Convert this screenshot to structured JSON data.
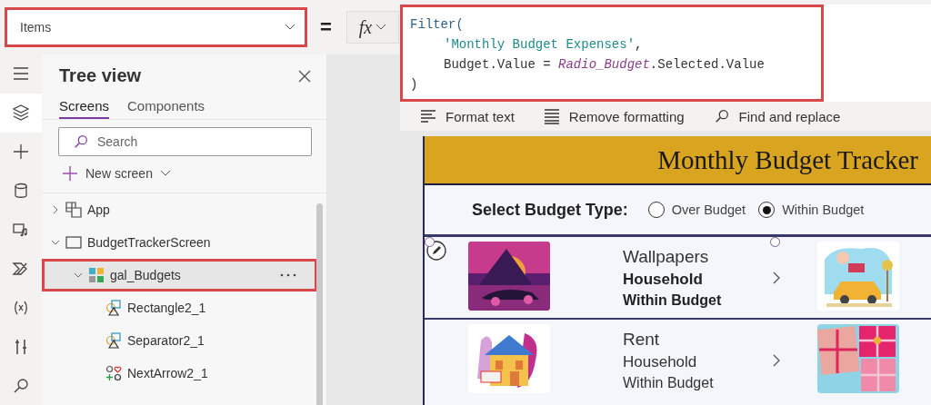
{
  "property_selector": {
    "value": "Items",
    "highlighted": true
  },
  "equals": "=",
  "fx_button": {
    "label": "fx"
  },
  "formula": {
    "highlighted": true,
    "lines": [
      {
        "indent": false,
        "tokens": [
          {
            "text": "Filter(",
            "kind": "function"
          }
        ]
      },
      {
        "indent": true,
        "tokens": [
          {
            "text": "'Monthly Budget Expenses'",
            "kind": "string"
          },
          {
            "text": ",",
            "kind": "plain"
          }
        ]
      },
      {
        "indent": true,
        "tokens": [
          {
            "text": "Budget.Value = ",
            "kind": "plain"
          },
          {
            "text": "Radio_Budget",
            "kind": "control"
          },
          {
            "text": ".Selected.Value",
            "kind": "plain"
          }
        ]
      },
      {
        "indent": false,
        "tokens": [
          {
            "text": ")",
            "kind": "plain"
          }
        ]
      }
    ]
  },
  "toolbar": [
    {
      "label": "Format text",
      "kind": "format"
    },
    {
      "label": "Remove formatting",
      "kind": "remove"
    },
    {
      "label": "Find and replace",
      "kind": "find"
    }
  ],
  "rail": [
    {
      "kind": "menu",
      "selected": false
    },
    {
      "kind": "tree",
      "selected": true
    },
    {
      "kind": "insert",
      "selected": false
    },
    {
      "kind": "data",
      "selected": false
    },
    {
      "kind": "media",
      "selected": false
    },
    {
      "kind": "flow",
      "selected": false
    },
    {
      "kind": "variables",
      "selected": false
    },
    {
      "kind": "tools",
      "selected": false
    },
    {
      "kind": "search",
      "selected": false
    }
  ],
  "tree_panel": {
    "title": "Tree view",
    "tabs": [
      {
        "label": "Screens",
        "selected": true
      },
      {
        "label": "Components",
        "selected": false
      }
    ],
    "search": {
      "placeholder": "Search"
    },
    "new_screen": "New screen",
    "items": [
      {
        "label": "App",
        "kind": "app",
        "expanded": false,
        "selected": false,
        "highlighted": false
      },
      {
        "label": "BudgetTrackerScreen",
        "kind": "screen",
        "expanded": true,
        "selected": false,
        "highlighted": false,
        "children": [
          {
            "label": "gal_Budgets",
            "kind": "gallery",
            "expanded": true,
            "selected": true,
            "highlighted": true,
            "children": [
              {
                "label": "Rectangle2_1",
                "kind": "shape",
                "selected": false,
                "highlighted": false
              },
              {
                "label": "Separator2_1",
                "kind": "shape",
                "selected": false,
                "highlighted": false
              },
              {
                "label": "NextArrow2_1",
                "kind": "icon",
                "selected": false,
                "highlighted": false
              }
            ]
          }
        ]
      }
    ]
  },
  "app_screen": {
    "title": "Monthly Budget Tracker",
    "radio_label": "Select Budget Type:",
    "options": [
      {
        "label": "Over Budget",
        "selected": false
      },
      {
        "label": "Within Budget",
        "selected": true
      }
    ],
    "rows": [
      {
        "title": "Wallpapers",
        "category": "Household",
        "status": "Within Budget",
        "selected": true
      },
      {
        "title": "Rent",
        "category": "Household",
        "status": "Within Budget",
        "selected": false
      }
    ]
  }
}
